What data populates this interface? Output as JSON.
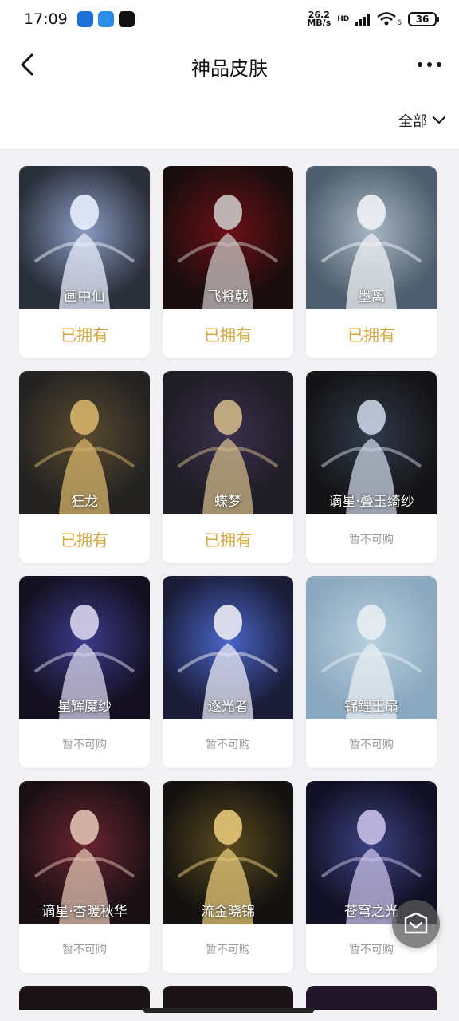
{
  "status_bar": {
    "time": "17:09",
    "net_speed_value": "26.2",
    "net_speed_unit": "MB/s",
    "wifi_badge": "6",
    "battery": "36",
    "signal": "HD"
  },
  "header": {
    "title": "神品皮肤"
  },
  "filter": {
    "label": "全部"
  },
  "items": [
    {
      "name": "画中仙",
      "status": "已拥有",
      "owned": true
    },
    {
      "name": "飞将戟",
      "status": "已拥有",
      "owned": true
    },
    {
      "name": "墨离",
      "status": "已拥有",
      "owned": true
    },
    {
      "name": "狂龙",
      "status": "已拥有",
      "owned": true
    },
    {
      "name": "蝶梦",
      "status": "已拥有",
      "owned": true
    },
    {
      "name": "谪星·叠玉绮纱",
      "status": "暂不可购",
      "owned": false
    },
    {
      "name": "星辉魔纱",
      "status": "暂不可购",
      "owned": false
    },
    {
      "name": "逐光者",
      "status": "暂不可购",
      "owned": false
    },
    {
      "name": "锦鲤玉扇",
      "status": "暂不可购",
      "owned": false
    },
    {
      "name": "谪星·杏暖秋华",
      "status": "暂不可购",
      "owned": false
    },
    {
      "name": "流金晓锦",
      "status": "暂不可购",
      "owned": false
    },
    {
      "name": "苍穹之光",
      "status": "暂不可购",
      "owned": false
    }
  ],
  "colors": {
    "owned": "#d9a63c",
    "unavailable": "#9a9a9a",
    "background": "#f2f2f4"
  }
}
